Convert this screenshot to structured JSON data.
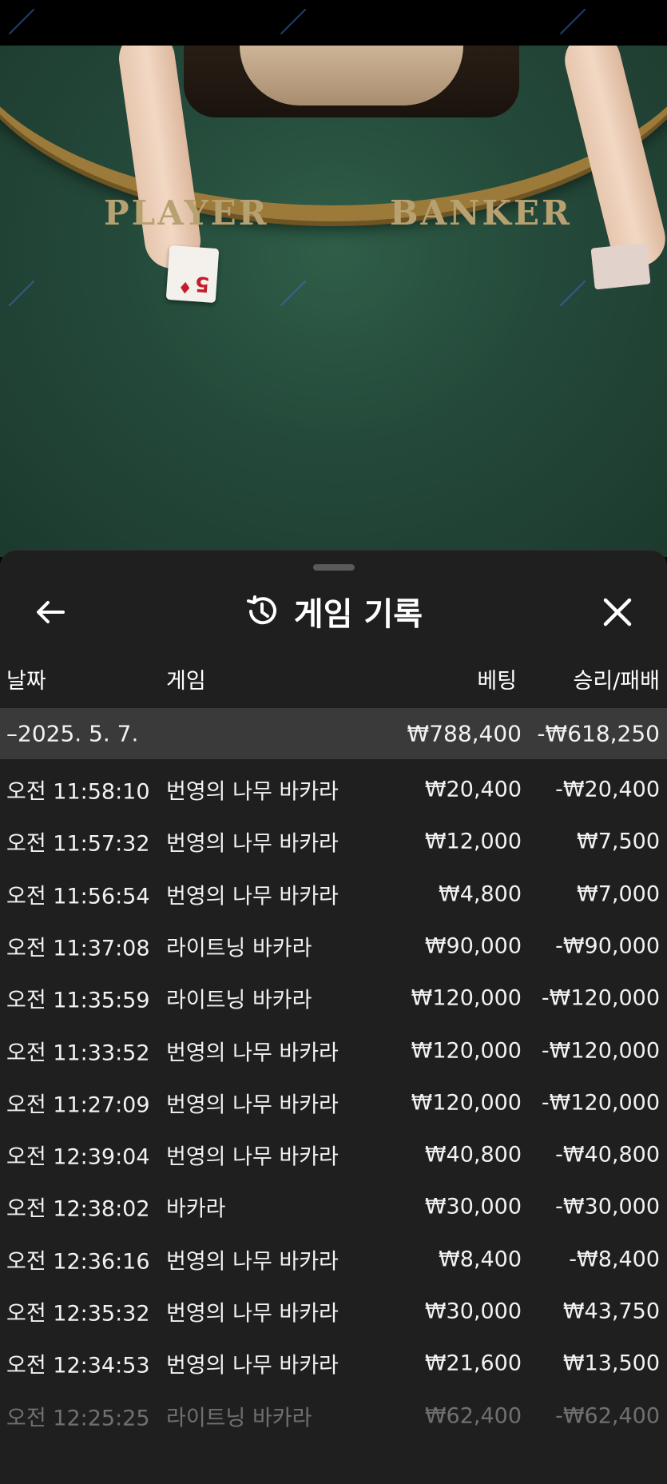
{
  "video": {
    "player_label": "PLAYER",
    "banker_label": "BANKER",
    "card_rank": "5",
    "card_suit": "♦"
  },
  "panel": {
    "title": "게임 기록",
    "headers": {
      "date": "날짜",
      "game": "게임",
      "bet": "베팅",
      "result": "승리/패배"
    },
    "date_group": {
      "date": "–2025. 5. 7.",
      "total_bet": "₩788,400",
      "total_result": "-₩618,250"
    },
    "rows": [
      {
        "time": "오전 11:58:10",
        "game": "번영의 나무 바카라",
        "bet": "₩20,400",
        "result": "-₩20,400"
      },
      {
        "time": "오전 11:57:32",
        "game": "번영의 나무 바카라",
        "bet": "₩12,000",
        "result": "₩7,500"
      },
      {
        "time": "오전 11:56:54",
        "game": "번영의 나무 바카라",
        "bet": "₩4,800",
        "result": "₩7,000"
      },
      {
        "time": "오전 11:37:08",
        "game": "라이트닝 바카라",
        "bet": "₩90,000",
        "result": "-₩90,000"
      },
      {
        "time": "오전 11:35:59",
        "game": "라이트닝 바카라",
        "bet": "₩120,000",
        "result": "-₩120,000"
      },
      {
        "time": "오전 11:33:52",
        "game": "번영의 나무 바카라",
        "bet": "₩120,000",
        "result": "-₩120,000"
      },
      {
        "time": "오전 11:27:09",
        "game": "번영의 나무 바카라",
        "bet": "₩120,000",
        "result": "-₩120,000"
      },
      {
        "time": "오전 12:39:04",
        "game": "번영의 나무 바카라",
        "bet": "₩40,800",
        "result": "-₩40,800"
      },
      {
        "time": "오전 12:38:02",
        "game": "바카라",
        "bet": "₩30,000",
        "result": "-₩30,000"
      },
      {
        "time": "오전 12:36:16",
        "game": "번영의 나무 바카라",
        "bet": "₩8,400",
        "result": "-₩8,400"
      },
      {
        "time": "오전 12:35:32",
        "game": "번영의 나무 바카라",
        "bet": "₩30,000",
        "result": "₩43,750"
      },
      {
        "time": "오전 12:34:53",
        "game": "번영의 나무 바카라",
        "bet": "₩21,600",
        "result": "₩13,500"
      },
      {
        "time": "오전 12:25:25",
        "game": "라이트닝 바카라",
        "bet": "₩62,400",
        "result": "-₩62,400"
      }
    ]
  },
  "icons": {
    "back": "arrow-left-icon",
    "history": "history-clock-icon",
    "close": "close-x-icon"
  }
}
